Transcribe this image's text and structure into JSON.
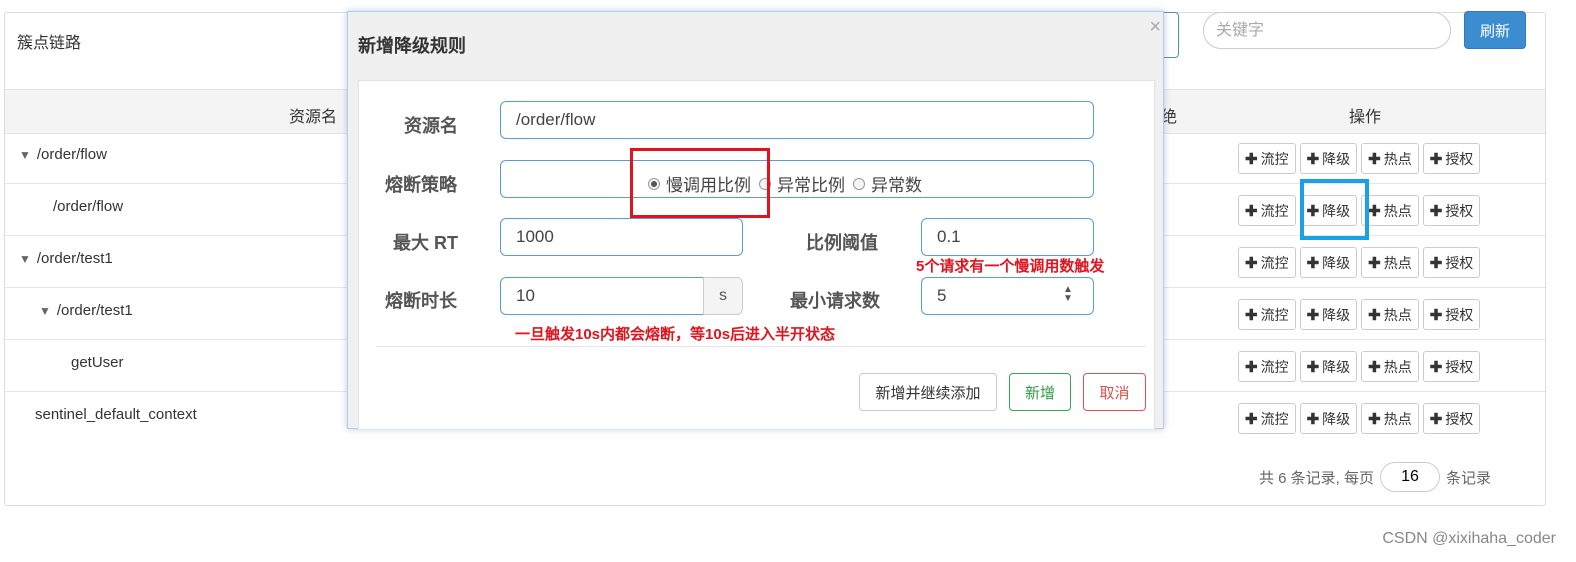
{
  "panel": {
    "title": "簇点链路"
  },
  "search": {
    "placeholder": "关键字",
    "refresh_label": "刷新"
  },
  "table": {
    "col_resource": "资源名",
    "col_partial": "绝",
    "col_ops": "操作",
    "rows": [
      {
        "name": "/order/flow",
        "arrow": "▼"
      },
      {
        "name": "/order/flow",
        "arrow": ""
      },
      {
        "name": "/order/test1",
        "arrow": "▼"
      },
      {
        "name": "/order/test1",
        "arrow": "▼"
      },
      {
        "name": "getUser",
        "arrow": ""
      },
      {
        "name": "sentinel_default_context",
        "arrow": ""
      }
    ],
    "op_labels": {
      "flow": "流控",
      "degrade": "降级",
      "hot": "热点",
      "auth": "授权"
    }
  },
  "pager": {
    "prefix": "共 6 条记录, 每页",
    "page_size": "16",
    "suffix": "条记录"
  },
  "modal": {
    "title": "新增降级规则",
    "close": "×",
    "resource_label": "资源名",
    "resource_value": "/order/flow",
    "strategy_label": "熔断策略",
    "strategy_options": [
      "慢调用比例",
      "异常比例",
      "异常数"
    ],
    "max_rt_label": "最大 RT",
    "max_rt_value": "1000",
    "ratio_label": "比例阈值",
    "ratio_value": "0.1",
    "duration_label": "熔断时长",
    "duration_value": "10",
    "duration_unit": "s",
    "min_req_label": "最小请求数",
    "min_req_value": "5",
    "btn_add_continue": "新增并继续添加",
    "btn_add": "新增",
    "btn_cancel": "取消"
  },
  "annotations": {
    "note_slow_call": "5个请求有一个慢调用数触发",
    "note_duration": "一旦触发10s内都会熔断，等10s后进入半开状态"
  },
  "watermark": "CSDN @xixihaha_coder",
  "colors": {
    "primary": "#3c8dcf",
    "annotation_red": "#e0141e",
    "highlight_blue": "#1aa0e6"
  }
}
